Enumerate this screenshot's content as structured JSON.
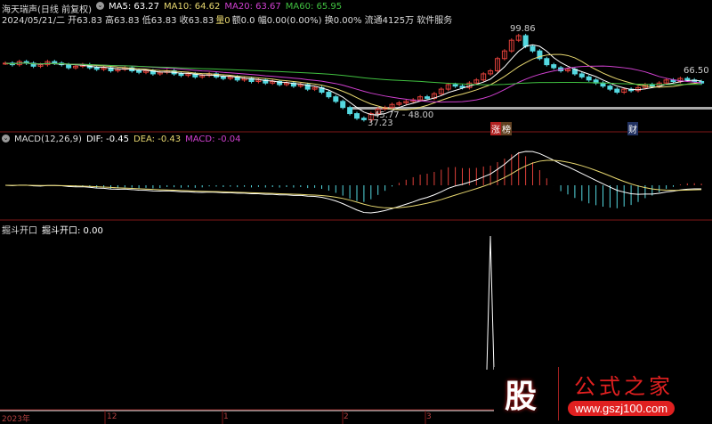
{
  "header": {
    "stock": "海天瑞声(日线 前复权)",
    "ma5": "MA5: 63.27",
    "ma10": "MA10: 64.62",
    "ma20": "MA20: 63.67",
    "ma60": "MA60: 65.95",
    "info": "2024/05/21/二 开63.83 高63.83 低63.83 收63.83",
    "vol": "量0",
    "info2": "额0.0 幅0.00(0.00%) 换0.00% 流通4125万 软件服务"
  },
  "annotations": {
    "high": "99.86",
    "low": "37.23",
    "range": "45.77 - 48.00",
    "right": "66.50",
    "tag1": "涨",
    "tag2": "榜",
    "tag3": "财"
  },
  "macd": {
    "title": "MACD(12,26,9)",
    "dif": "DIF: -0.45",
    "dea": "DEA: -0.43",
    "macd": "MACD: -0.04"
  },
  "ind3": {
    "title": "掘斗开口",
    "label": "掘斗开口: 0.00"
  },
  "axis": [
    "2023年",
    "12",
    "1",
    "2",
    "3"
  ],
  "watermark": {
    "logo": "股",
    "name": "公式之家",
    "url": "www.gszj100.com"
  },
  "colors": {
    "up": "#e0403a",
    "down": "#54d8e0",
    "ma5": "#ffffff",
    "ma10": "#e8d870",
    "ma20": "#d040d0",
    "ma60": "#40c040"
  },
  "chart_data": {
    "type": "candlestick",
    "closes": [
      77,
      76,
      78,
      77,
      75,
      76,
      78,
      77,
      76,
      74,
      75,
      76,
      74,
      73,
      74,
      72,
      73,
      74,
      72,
      71,
      72,
      70,
      71,
      72,
      70,
      69,
      70,
      68,
      69,
      70,
      68,
      67,
      68,
      66,
      67,
      65,
      66,
      64,
      65,
      63,
      64,
      62,
      63,
      60,
      61,
      58,
      55,
      52,
      48,
      44,
      41,
      40,
      44,
      47,
      48,
      50,
      51,
      52,
      53,
      55,
      54,
      57,
      60,
      63,
      62,
      61,
      64,
      66,
      70,
      72,
      80,
      85,
      92,
      95,
      88,
      85,
      80,
      76,
      74,
      72,
      73,
      70,
      68,
      66,
      64,
      62,
      60,
      58,
      60,
      59,
      61,
      63,
      62,
      64,
      66,
      65,
      67,
      66,
      65,
      64
    ],
    "yrange": [
      35,
      102
    ],
    "indicator_spike_index": 70,
    "indicator_values_note": "0 except spike"
  }
}
